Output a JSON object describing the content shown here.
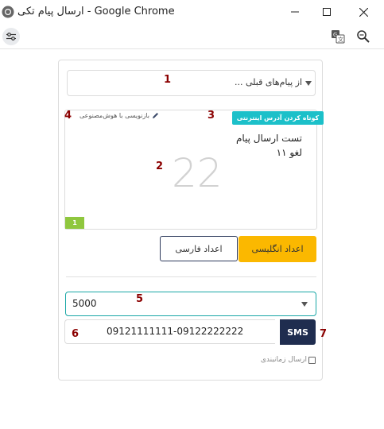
{
  "window": {
    "title": "ارسال پیام تکی - Google Chrome"
  },
  "form": {
    "previous_messages_placeholder": "از پیام‌های قبلی ...",
    "shorten_url_label": "کوتاه کردن آدرس اینترنتی",
    "ai_rewrite_label": "بازنویسی با هوش‌مصنوعی",
    "message_line1": "تست ارسال پیام",
    "message_line2": "لغو ۱۱",
    "char_count": "22",
    "sms_count": "1",
    "english_digits_label": "اعداد انگلیسی",
    "persian_digits_label": "اعداد فارسی",
    "sender_line_value": "5000‏",
    "receivers_value": "09121111111-09122222222",
    "sms_label": "SMS",
    "scheduled_label": "ارسال زمانبندی"
  },
  "markers": {
    "m1": "1",
    "m2": "2",
    "m3": "3",
    "m4": "4",
    "m5": "5",
    "m6": "6",
    "m7": "7"
  },
  "colors": {
    "accent_teal": "#1cc0c9",
    "english_button": "#fbb800",
    "sms_badge": "#1f2d4f",
    "sms_count": "#8fc73e",
    "marker": "#8b0000"
  },
  "icons": {
    "window": "chrome-logo-icon",
    "site_info": "tune-icon",
    "translate": "translate-icon",
    "zoom": "zoom-icon",
    "ai": "pencil-icon"
  }
}
